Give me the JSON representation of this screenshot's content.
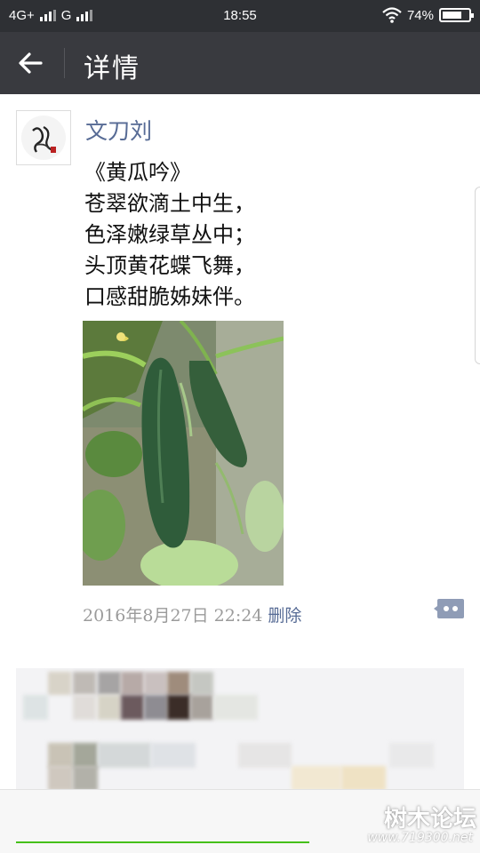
{
  "status_bar": {
    "network": "4G+",
    "network2": "G",
    "time": "18:55",
    "battery": "74%",
    "battery_level": 0.74
  },
  "header": {
    "title": "详情",
    "back_icon": "arrow-left-icon"
  },
  "post": {
    "author": "文刀刘",
    "text": "《黄瓜吟》\n苍翠欲滴土中生，\n色泽嫩绿草丛中；\n头顶黄花蝶飞舞，\n口感甜脆姊妹伴。",
    "date": "2016年8月27日 22:24",
    "delete_label": "删除",
    "comment_icon": "comment-dots-icon"
  },
  "watermark": {
    "text": "树木论坛",
    "url": "www.719300.net"
  },
  "colors": {
    "header_bg": "#393a3f",
    "status_bg": "#2e3034",
    "link": "#576b95",
    "accent_green": "#45c01a"
  }
}
